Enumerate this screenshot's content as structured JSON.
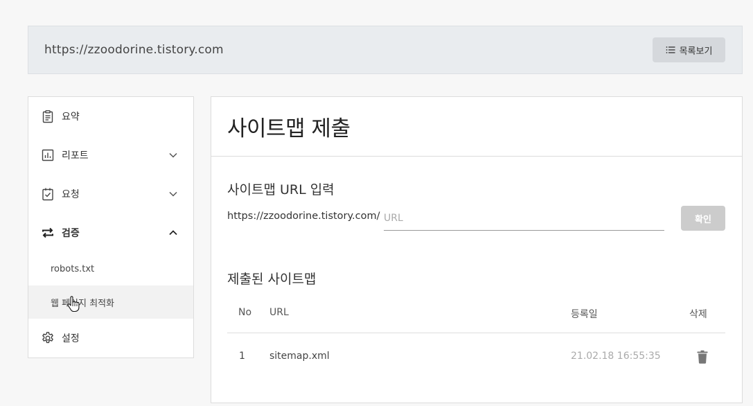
{
  "site": {
    "url": "https://zzoodorine.tistory.com",
    "list_button_label": "목록보기",
    "list_button_icon": "list-icon"
  },
  "sidebar": {
    "items": [
      {
        "label": "요약",
        "icon": "clipboard-icon"
      },
      {
        "label": "리포트",
        "icon": "bar-chart-icon",
        "expanded": false
      },
      {
        "label": "요청",
        "icon": "clipboard-check-icon",
        "expanded": false
      },
      {
        "label": "검증",
        "icon": "repeat-icon",
        "expanded": true,
        "subitems": [
          {
            "label": "robots.txt"
          },
          {
            "label": "웹 페이지 최적화",
            "active": true
          }
        ]
      },
      {
        "label": "설정",
        "icon": "gear-icon"
      }
    ]
  },
  "main": {
    "title": "사이트맵 제출",
    "input_section": {
      "title": "사이트맵 URL 입력",
      "prefix": "https://zzoodorine.tistory.com/",
      "placeholder": "URL",
      "value": "",
      "confirm_label": "확인"
    },
    "submitted_section": {
      "title": "제출된 사이트맵",
      "columns": [
        "No",
        "URL",
        "등록일",
        "삭제"
      ],
      "rows": [
        {
          "no": "1",
          "url": "sitemap.xml",
          "date": "21.02.18 16:55:35",
          "delete_icon": "trash-icon"
        }
      ]
    }
  },
  "colors": {
    "site_bar_bg": "#e9ecef",
    "confirm_button_disabled": "#cccccc",
    "date_text": "#aaaaaa"
  }
}
